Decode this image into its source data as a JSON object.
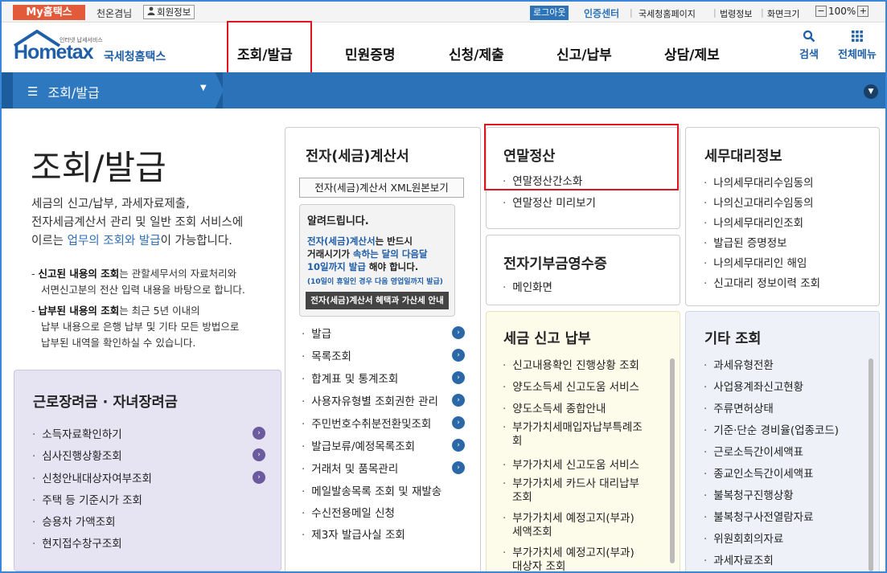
{
  "topbar": {
    "my_hometax": "My홈택스",
    "user_name": "천온겸님",
    "member_info": "회원정보",
    "logout": "로그아웃",
    "certificate_center": "인증센터",
    "links": [
      "국세청홈페이지",
      "법령정보",
      "화면크기"
    ],
    "zoom_minus": "−",
    "zoom_level": "100%",
    "zoom_plus": "+"
  },
  "header": {
    "logo_tagline": "인터넷 납세서비스",
    "logo_main": "Hometax",
    "logo_sub": "국세청홈택스",
    "nav": [
      "조회/발급",
      "민원증명",
      "신청/제출",
      "신고/납부",
      "상담/제보"
    ],
    "search_label": "검색",
    "menu_label": "전체메뉴"
  },
  "section_bar": {
    "title": "조회/발급"
  },
  "intro": {
    "title": "조회/발급",
    "desc_1": "세금의 신고/납부, 과세자료제출,",
    "desc_2": "전자세금계산서 관리 및 일반 조회 서비스에",
    "desc_3a": "이르는 ",
    "desc_3b": "업무의 조회와 발급",
    "desc_3c": "이 가능합니다.",
    "note1_bold": "신고된 내용의 조회",
    "note1_rest_1": "는 관할세무서의 자료처리와",
    "note1_rest_2": "서면신고분의 전산 입력 내용을 바탕으로 합니다.",
    "note2_bold": "납부된 내용의 조회",
    "note2_rest_1": "는 최근 5년 이내의",
    "note2_rest_2": "납부 내용으로 은행 납부 및 기타 모든 방법으로",
    "note2_rest_3": "납부된 내역을 확인하실 수 있습니다."
  },
  "box_work": {
    "title": "근로장려금 · 자녀장려금",
    "items": [
      "소득자료확인하기",
      "심사진행상황조회",
      "신청안내대상자여부조회",
      "주택 등 기준시가 조회",
      "승용차 가액조회",
      "현지접수창구조회"
    ]
  },
  "box_etax": {
    "title": "전자(세금)계산서",
    "xml_button": "전자(세금)계산서 XML원본보기",
    "notice_title": "알려드립니다.",
    "notice_line1a": "전자(세금)계산서",
    "notice_line1b": "는 반드시",
    "notice_line2a": "거래시기가 ",
    "notice_line2b": "속하는 달의 다음달",
    "notice_line3a": "10일까지 발급",
    "notice_line3b": " 해야 합니다.",
    "notice_small": "(10일이 휴일인 경우 다음 영업일까지 발급)",
    "notice_button": "전자(세금)계산서 혜택과 가산세 안내",
    "items": [
      "발급",
      "목록조회",
      "합계표 및 통계조회",
      "사용자유형별 조회권한 관리",
      "주민번호수취분전환및조회",
      "발급보류/예정목록조회",
      "거래처 및 품목관리",
      "메일발송목록 조회 및 재발송",
      "수신전용메일 신청",
      "제3자 발급사실 조회"
    ]
  },
  "box_year_end": {
    "title": "연말정산",
    "items": [
      "연말정산간소화",
      "연말정산 미리보기"
    ]
  },
  "box_donation": {
    "title": "전자기부금영수증",
    "items": [
      "메인화면"
    ]
  },
  "box_tax_report": {
    "title": "세금 신고 납부",
    "items": [
      "신고내용확인 진행상황 조회",
      "양도소득세 신고도움 서비스",
      "양도소득세 종합안내",
      "부가가치세매입자납부특례조|회",
      "부가가치세 신고도움 서비스",
      "부가가치세 카드사 대리납부|조회",
      "부가가치세 예정고지(부과)|세액조회",
      "부가가치세 예정고지(부과)|대상자 조회"
    ]
  },
  "box_agent": {
    "title": "세무대리정보",
    "items": [
      "나의세무대리수임동의",
      "나의신고대리수임동의",
      "나의세무대리인조회",
      "발급된 증명정보",
      "나의세무대리인 해임",
      "신고대리 정보이력 조회"
    ]
  },
  "box_other": {
    "title": "기타 조회",
    "items": [
      "과세유형전환",
      "사업용계좌신고현황",
      "주류면허상태",
      "기준·단순 경비율(업종코드)",
      "근로소득간이세액표",
      "종교인소득간이세액표",
      "불복청구진행상황",
      "불복청구사전열람자료",
      "위원회회의자료",
      "과세자료조회"
    ]
  },
  "colors": {
    "brand_blue": "#1d5d9d",
    "highlight_red": "#e0141e",
    "my_hometax": "#e35a3a"
  }
}
